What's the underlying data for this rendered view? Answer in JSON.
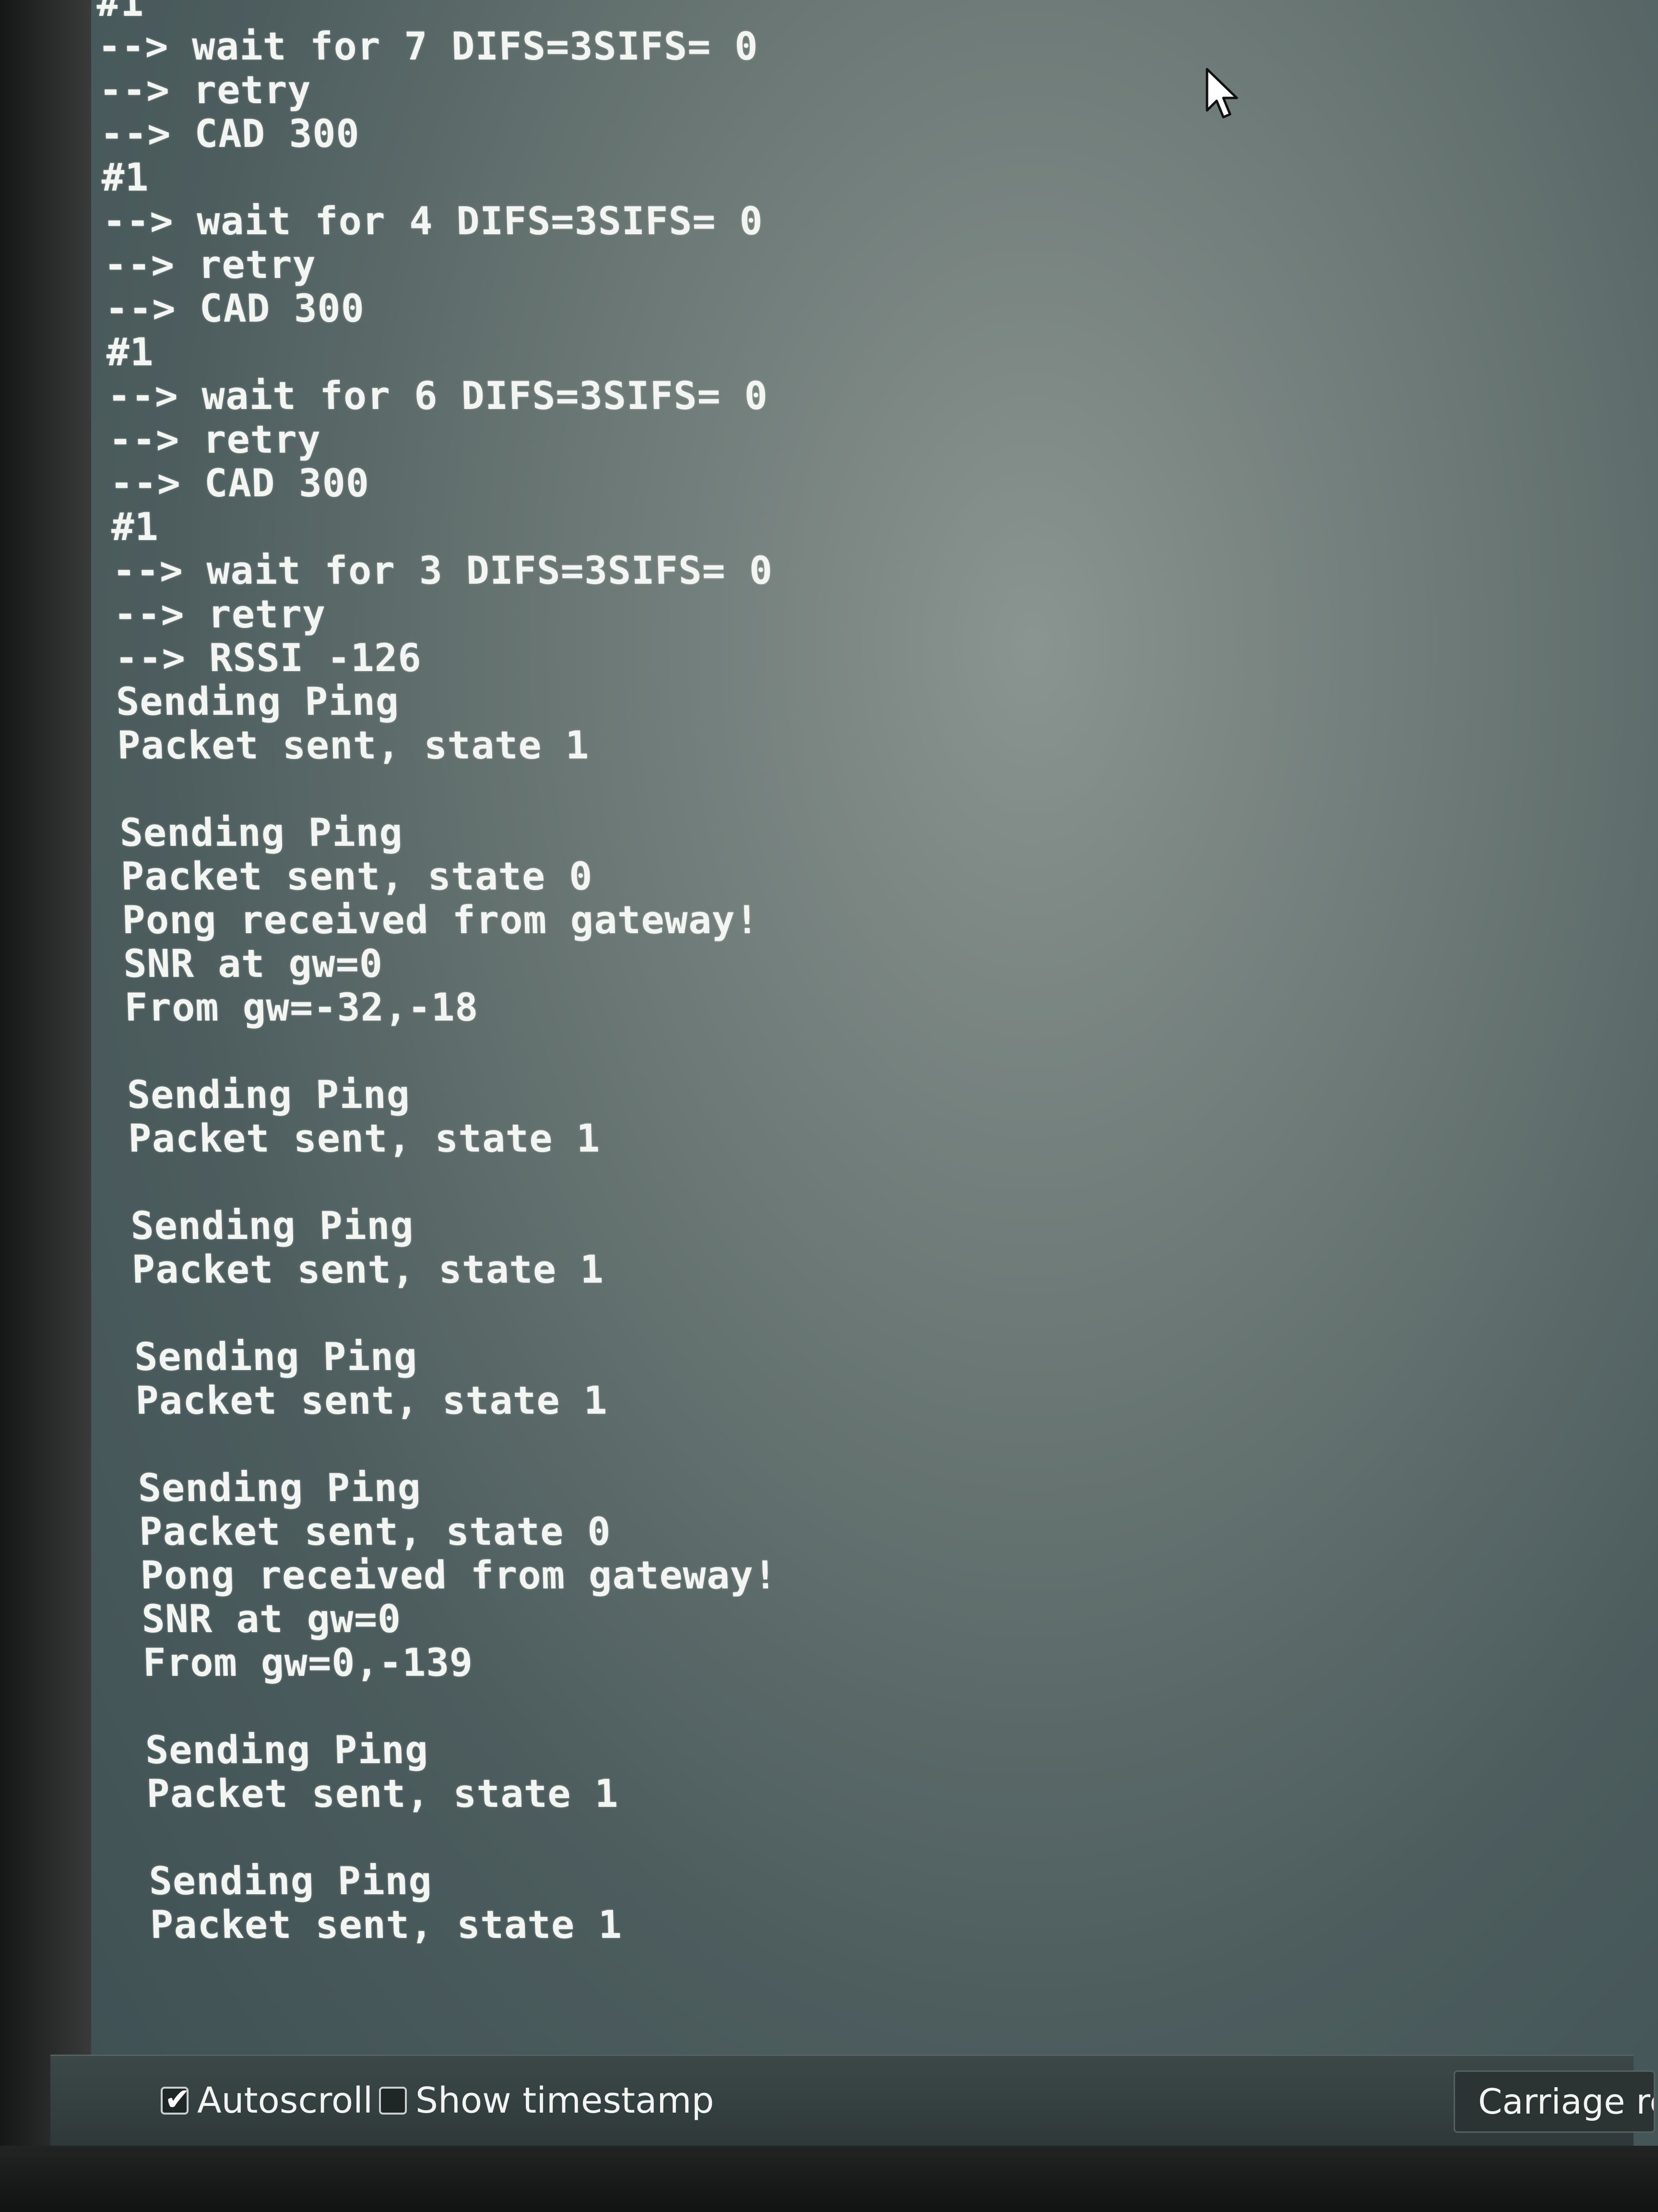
{
  "serial_monitor": {
    "output_lines": [
      "#1",
      "--> wait for 7 DIFS=3SIFS= 0",
      "--> retry",
      "--> CAD 300",
      "#1",
      "--> wait for 4 DIFS=3SIFS= 0",
      "--> retry",
      "--> CAD 300",
      "#1",
      "--> wait for 6 DIFS=3SIFS= 0",
      "--> retry",
      "--> CAD 300",
      "#1",
      "--> wait for 3 DIFS=3SIFS= 0",
      "--> retry",
      "--> RSSI -126",
      "Sending Ping",
      "Packet sent, state 1",
      "",
      "Sending Ping",
      "Packet sent, state 0",
      "Pong received from gateway!",
      "SNR at gw=0",
      "From gw=-32,-18",
      "",
      "Sending Ping",
      "Packet sent, state 1",
      "",
      "Sending Ping",
      "Packet sent, state 1",
      "",
      "Sending Ping",
      "Packet sent, state 1",
      "",
      "Sending Ping",
      "Packet sent, state 0",
      "Pong received from gateway!",
      "SNR at gw=0",
      "From gw=0,-139",
      "",
      "Sending Ping",
      "Packet sent, state 1",
      "",
      "Sending Ping",
      "Packet sent, state 1"
    ]
  },
  "footer": {
    "autoscroll_label": "Autoscroll",
    "autoscroll_checked": true,
    "timestamp_label": "Show timestamp",
    "timestamp_checked": false,
    "line_ending_value": "Carriage re"
  },
  "icons": {
    "cursor": "mouse-pointer-icon",
    "check": "checkmark-icon"
  }
}
